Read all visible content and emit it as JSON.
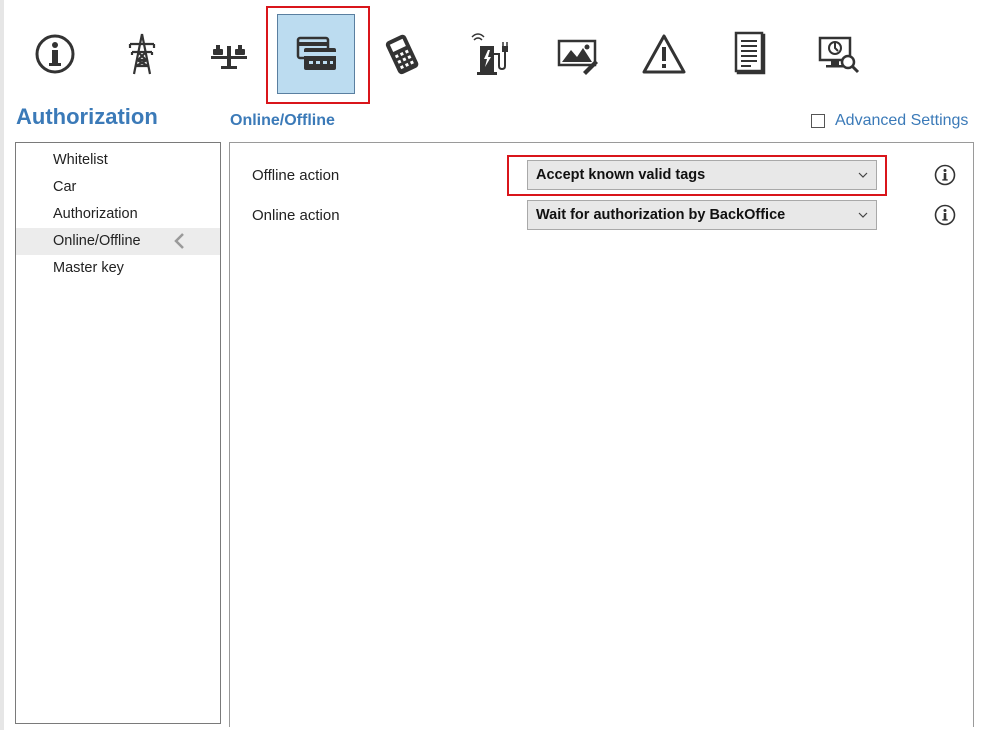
{
  "toolbar": {
    "items": [
      {
        "name": "info-icon"
      },
      {
        "name": "power-tower-icon"
      },
      {
        "name": "balance-scale-icon"
      },
      {
        "name": "payment-cards-icon",
        "active": true
      },
      {
        "name": "card-terminal-icon"
      },
      {
        "name": "charging-station-icon"
      },
      {
        "name": "image-icon"
      },
      {
        "name": "warning-icon"
      },
      {
        "name": "document-icon"
      },
      {
        "name": "monitor-diagnostics-icon"
      }
    ]
  },
  "section": {
    "title": "Authorization"
  },
  "panel": {
    "title": "Online/Offline"
  },
  "advanced": {
    "label": "Advanced Settings",
    "checked": false
  },
  "nav": {
    "items": [
      {
        "label": "Whitelist"
      },
      {
        "label": "Car"
      },
      {
        "label": "Authorization"
      },
      {
        "label": "Online/Offline",
        "selected": true
      },
      {
        "label": "Master key"
      }
    ]
  },
  "settings": {
    "offline": {
      "label": "Offline action",
      "value": "Accept known valid tags"
    },
    "online": {
      "label": "Online action",
      "value": "Wait for authorization by BackOffice"
    }
  },
  "colors": {
    "accent": "#3b7ab8",
    "highlight": "#d9151b",
    "active_bg": "#bcdcf0"
  }
}
